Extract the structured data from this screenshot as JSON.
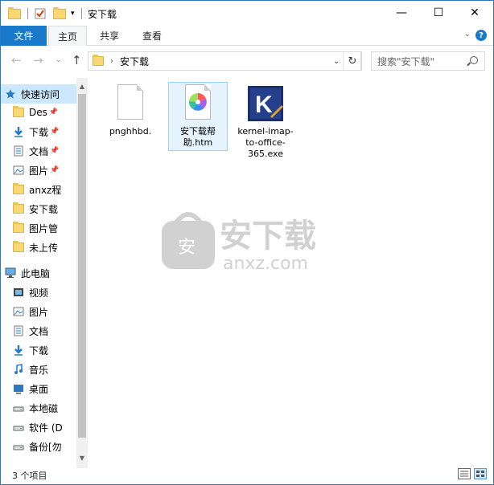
{
  "window": {
    "title": "安下载",
    "controls": {
      "minimize": "—",
      "maximize": "☐",
      "close": "✕"
    }
  },
  "ribbon": {
    "tabs": [
      {
        "label": "文件"
      },
      {
        "label": "主页"
      },
      {
        "label": "共享"
      },
      {
        "label": "查看"
      }
    ],
    "help": "?"
  },
  "address": {
    "path": "安下载",
    "search_placeholder": "搜索\"安下载\""
  },
  "nav": {
    "items": [
      {
        "label": "快速访问",
        "icon": "star-icon",
        "pinned": false,
        "selected": true
      },
      {
        "label": "Des",
        "icon": "folder-icon",
        "pinned": true
      },
      {
        "label": "下载",
        "icon": "download-icon",
        "pinned": true
      },
      {
        "label": "文档",
        "icon": "document-icon",
        "pinned": true
      },
      {
        "label": "图片",
        "icon": "picture-icon",
        "pinned": true
      },
      {
        "label": "anxz程",
        "icon": "folder-icon",
        "pinned": false
      },
      {
        "label": "安下载",
        "icon": "folder-icon",
        "pinned": false
      },
      {
        "label": "图片管",
        "icon": "folder-icon",
        "pinned": false
      },
      {
        "label": "未上传",
        "icon": "folder-icon",
        "pinned": false
      },
      {
        "label": "此电脑",
        "icon": "computer-icon",
        "pinned": false
      },
      {
        "label": "视频",
        "icon": "video-icon",
        "pinned": false
      },
      {
        "label": "图片",
        "icon": "picture-icon",
        "pinned": false
      },
      {
        "label": "文档",
        "icon": "document-icon",
        "pinned": false
      },
      {
        "label": "下载",
        "icon": "download-icon",
        "pinned": false
      },
      {
        "label": "音乐",
        "icon": "music-icon",
        "pinned": false
      },
      {
        "label": "桌面",
        "icon": "desktop-icon",
        "pinned": false
      },
      {
        "label": "本地磁",
        "icon": "drive-icon",
        "pinned": false
      },
      {
        "label": "软件 (D",
        "icon": "drive-icon",
        "pinned": false
      },
      {
        "label": "备份[勿",
        "icon": "drive-icon",
        "pinned": false
      }
    ]
  },
  "files": [
    {
      "name": "pnghhbd.",
      "icon": "blank-file-icon"
    },
    {
      "name": "安下载帮助.htm",
      "icon": "htm-file-icon"
    },
    {
      "name": "kernel-imap-to-office-365.exe",
      "icon": "kernel-app-icon"
    }
  ],
  "watermark": {
    "text": "安下载",
    "subtext": "anxz.com"
  },
  "status": {
    "count": "3 个项目"
  },
  "colors": {
    "accent": "#1979ca",
    "selection": "#cce8ff",
    "folder": "#f8d775"
  }
}
